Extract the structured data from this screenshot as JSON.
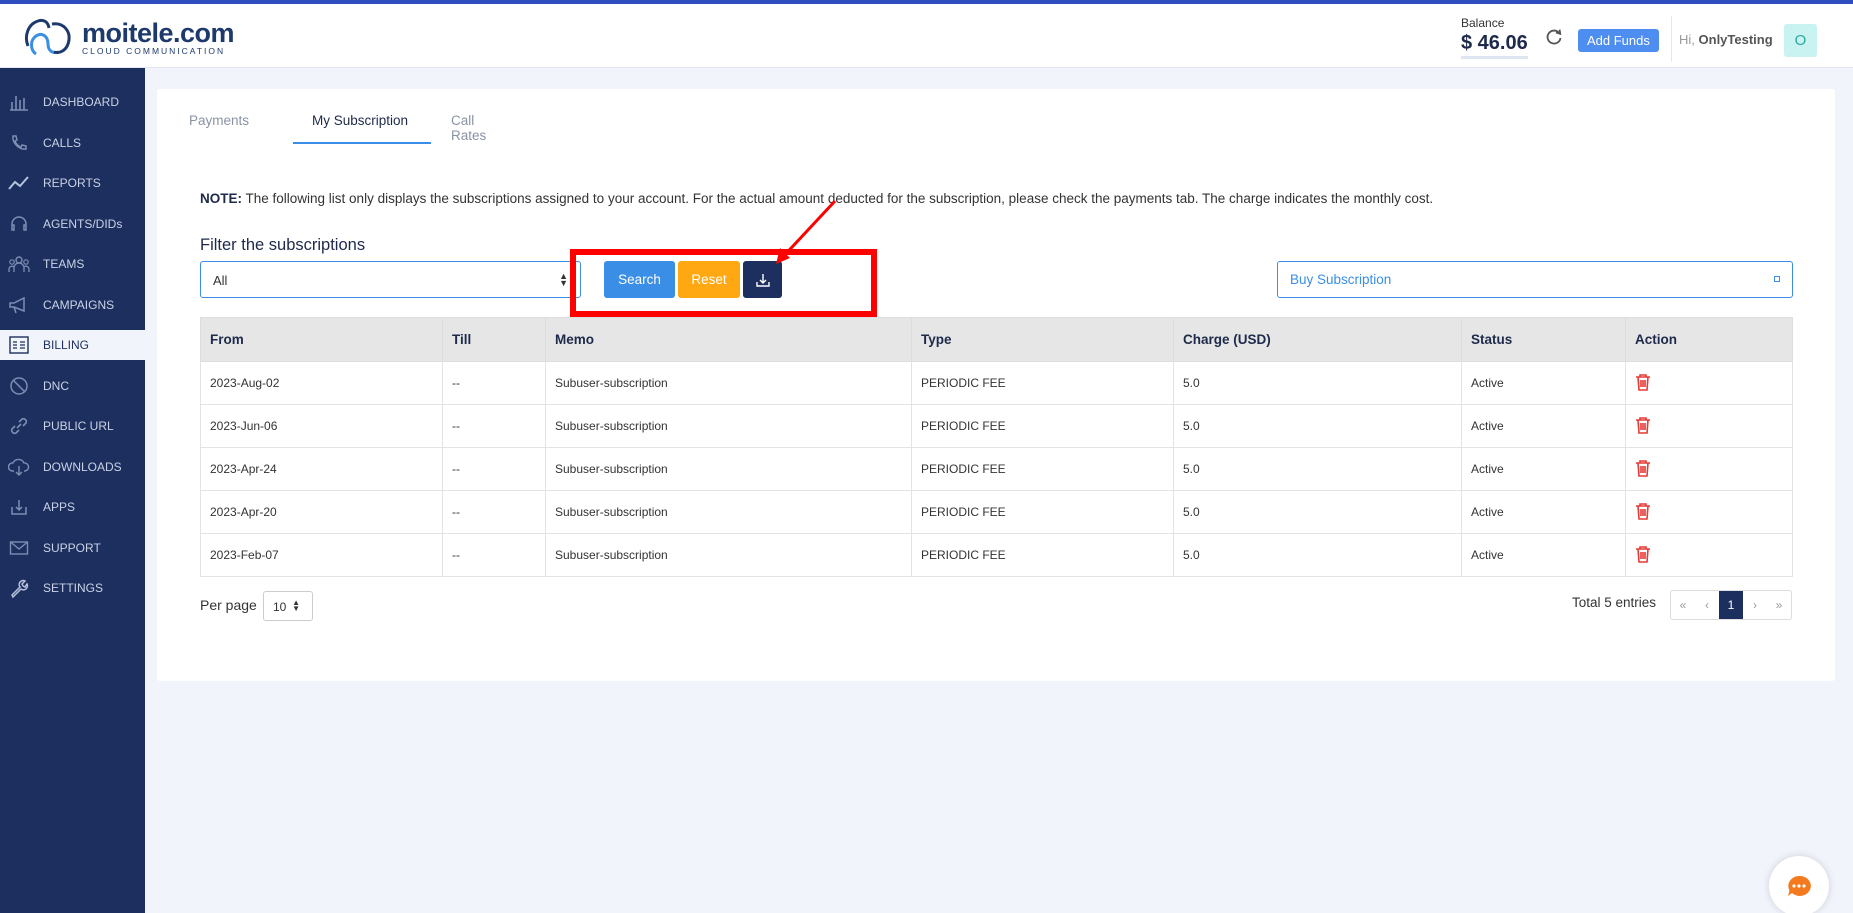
{
  "header": {
    "logo_name": "moitele.com",
    "logo_sub": "CLOUD COMMUNICATION",
    "balance_label": "Balance",
    "balance_value": "$ 46.06",
    "add_funds": "Add Funds",
    "greet_prefix": "Hi,",
    "user": "OnlyTesting",
    "avatar": "O"
  },
  "sidebar": {
    "items": [
      {
        "label": "DASHBOARD",
        "icon": "dashboard-icon"
      },
      {
        "label": "CALLS",
        "icon": "phone-icon"
      },
      {
        "label": "REPORTS",
        "icon": "chart-line-icon"
      },
      {
        "label": "AGENTS/DIDs",
        "icon": "headset-icon"
      },
      {
        "label": "TEAMS",
        "icon": "team-icon"
      },
      {
        "label": "CAMPAIGNS",
        "icon": "megaphone-icon"
      },
      {
        "label": "BILLING",
        "icon": "invoice-icon",
        "active": true
      },
      {
        "label": "DNC",
        "icon": "block-icon"
      },
      {
        "label": "PUBLIC URL",
        "icon": "link-icon"
      },
      {
        "label": "DOWNLOADS",
        "icon": "cloud-download-icon"
      },
      {
        "label": "APPS",
        "icon": "download-tray-icon"
      },
      {
        "label": "SUPPORT",
        "icon": "mail-icon"
      },
      {
        "label": "SETTINGS",
        "icon": "wrench-icon"
      }
    ]
  },
  "tabs": [
    "Payments",
    "My Subscription",
    "Call Rates"
  ],
  "note": {
    "bold": "NOTE:",
    "text": " The following list only displays the subscriptions assigned to your account. For the actual amount deducted for the subscription, please check the payments tab. The charge indicates the monthly cost."
  },
  "filter": {
    "title": "Filter the subscriptions",
    "select_value": "All",
    "search": "Search",
    "reset": "Reset",
    "buy": "Buy Subscription"
  },
  "table": {
    "headers": [
      "From",
      "Till",
      "Memo",
      "Type",
      "Charge (USD)",
      "Status",
      "Action"
    ],
    "rows": [
      [
        "2023-Aug-02",
        "--",
        "Subuser-subscription",
        "PERIODIC FEE",
        "5.0",
        "Active"
      ],
      [
        "2023-Jun-06",
        "--",
        "Subuser-subscription",
        "PERIODIC FEE",
        "5.0",
        "Active"
      ],
      [
        "2023-Apr-24",
        "--",
        "Subuser-subscription",
        "PERIODIC FEE",
        "5.0",
        "Active"
      ],
      [
        "2023-Apr-20",
        "--",
        "Subuser-subscription",
        "PERIODIC FEE",
        "5.0",
        "Active"
      ],
      [
        "2023-Feb-07",
        "--",
        "Subuser-subscription",
        "PERIODIC FEE",
        "5.0",
        "Active"
      ]
    ]
  },
  "pagination": {
    "per_page_label": "Per page",
    "per_page_value": "10",
    "total": "Total 5 entries",
    "first": "«",
    "prev": "‹",
    "current": "1",
    "next": "›",
    "last": "»"
  },
  "colors": {
    "sidebar": "#1d2f5e",
    "primary": "#3a8ee6",
    "reset": "#ffa811",
    "highlight": "#ff0000",
    "delete": "#e53935"
  }
}
